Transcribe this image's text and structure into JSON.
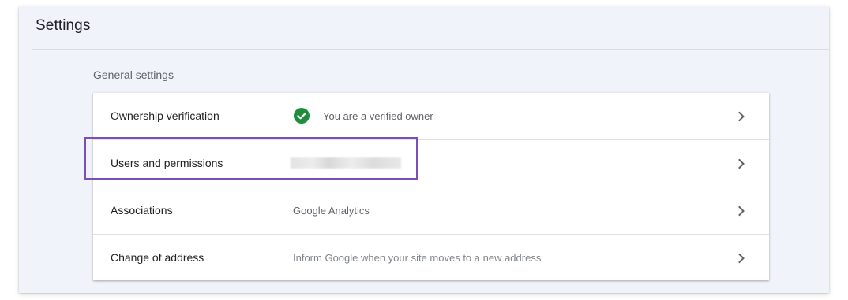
{
  "header": {
    "title": "Settings"
  },
  "section": {
    "title": "General settings"
  },
  "rows": [
    {
      "label": "Ownership verification",
      "value": "You are a verified owner",
      "icon": "check-circle-icon"
    },
    {
      "label": "Users and permissions",
      "value": "",
      "value_redacted": true
    },
    {
      "label": "Associations",
      "value": "Google Analytics"
    },
    {
      "label": "Change of address",
      "value": "Inform Google when your site moves to a new address"
    }
  ],
  "colors": {
    "verified_green": "#1e8e3e",
    "highlight_purple": "#7b4fb5",
    "panel_background": "#f1f3fb"
  }
}
